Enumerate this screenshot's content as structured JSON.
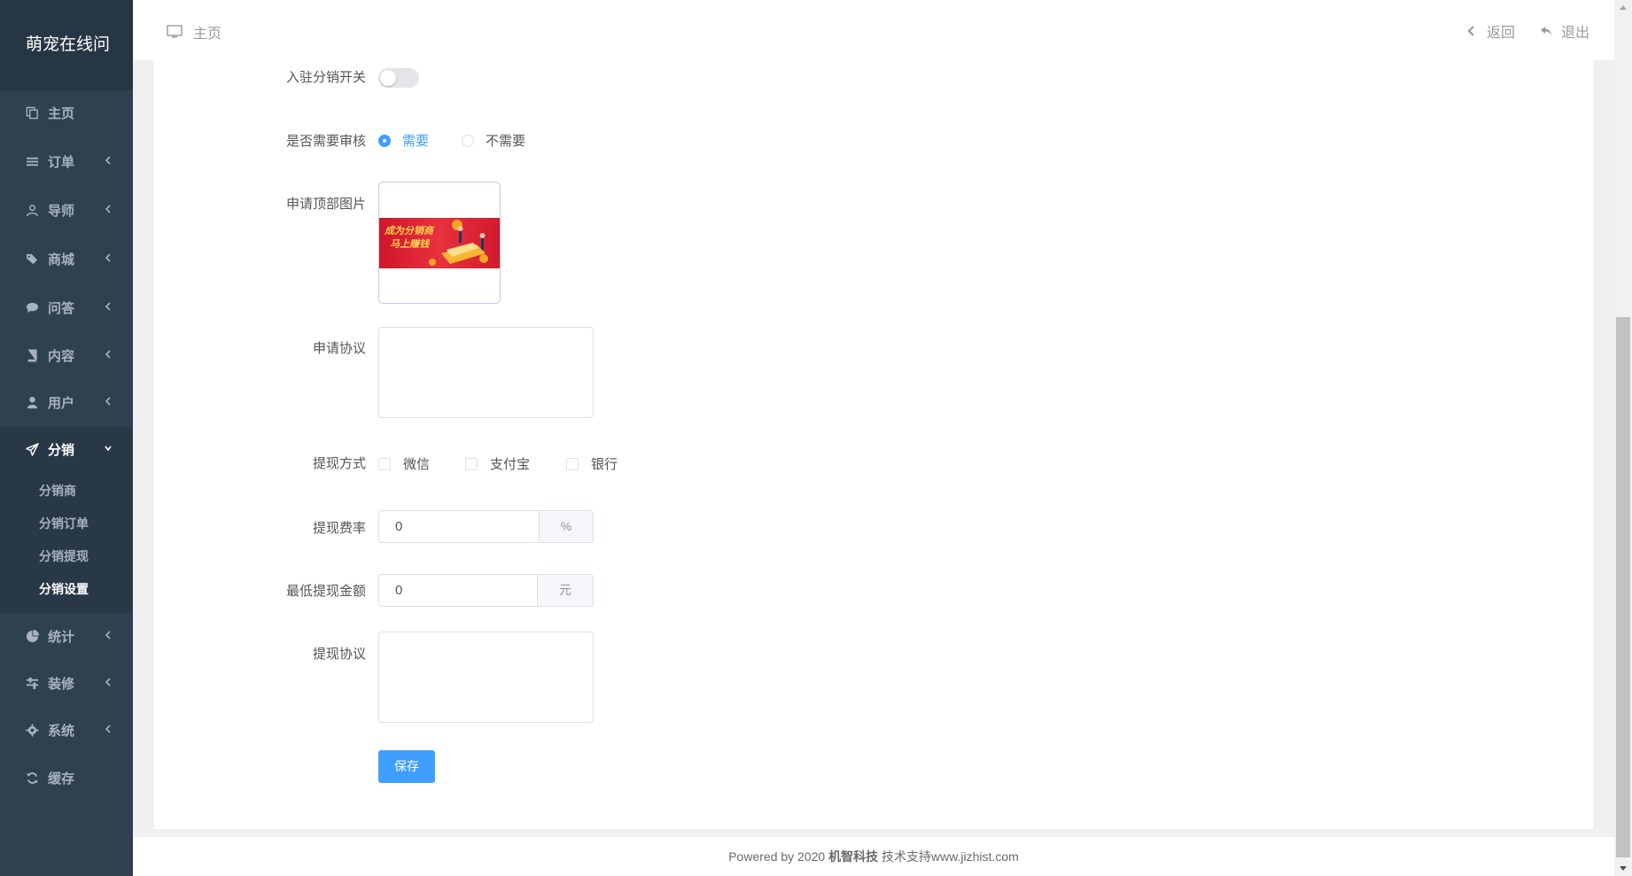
{
  "brand": "萌宠在线问",
  "sidebar": {
    "items": [
      {
        "label": "主页",
        "icon": "copy-icon",
        "has_arrow": false
      },
      {
        "label": "订单",
        "icon": "list-icon",
        "has_arrow": true
      },
      {
        "label": "导师",
        "icon": "user-outline-icon",
        "has_arrow": true
      },
      {
        "label": "商城",
        "icon": "tags-icon",
        "has_arrow": true
      },
      {
        "label": "问答",
        "icon": "comment-icon",
        "has_arrow": true
      },
      {
        "label": "内容",
        "icon": "book-icon",
        "has_arrow": true
      },
      {
        "label": "用户",
        "icon": "user-icon",
        "has_arrow": true
      },
      {
        "label": "分销",
        "icon": "paper-plane-icon",
        "has_arrow": true,
        "expanded": true
      },
      {
        "label": "统计",
        "icon": "pie-chart-icon",
        "has_arrow": true
      },
      {
        "label": "装修",
        "icon": "sliders-icon",
        "has_arrow": true
      },
      {
        "label": "系统",
        "icon": "gear-icon",
        "has_arrow": true
      },
      {
        "label": "缓存",
        "icon": "refresh-icon",
        "has_arrow": false
      }
    ],
    "sub_items": [
      {
        "label": "分销商",
        "active": false
      },
      {
        "label": "分销订单",
        "active": false
      },
      {
        "label": "分销提现",
        "active": false
      },
      {
        "label": "分销设置",
        "active": true
      }
    ]
  },
  "topbar": {
    "breadcrumb": "主页",
    "back_label": "返回",
    "logout_label": "退出"
  },
  "form": {
    "switch_label": "入驻分销开关",
    "switch_on": false,
    "review_label": "是否需要审核",
    "review_options": [
      "需要",
      "不需要"
    ],
    "review_selected": "需要",
    "image_label": "申请顶部图片",
    "banner_text_line1": "成为分销商",
    "banner_text_line2": "马上赚钱",
    "agreement_label": "申请协议",
    "agreement_value": "",
    "withdraw_method_label": "提现方式",
    "withdraw_methods": [
      "微信",
      "支付宝",
      "银行"
    ],
    "fee_rate_label": "提现费率",
    "fee_rate_value": "0",
    "fee_rate_unit": "%",
    "min_amount_label": "最低提现金额",
    "min_amount_value": "0",
    "min_amount_unit": "元",
    "withdraw_agreement_label": "提现协议",
    "withdraw_agreement_value": "",
    "save_label": "保存"
  },
  "footer": {
    "prefix": "Powered by 2020",
    "company": "机智科技",
    "suffix": "技术支持www.jizhist.com"
  },
  "colors": {
    "sidebar_bg": "#2f4050",
    "accent": "#409eff"
  }
}
